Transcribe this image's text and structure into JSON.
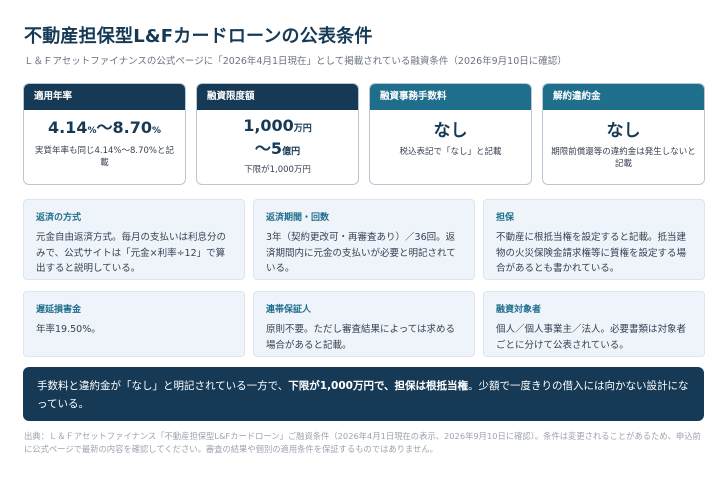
{
  "page": {
    "title": "不動産担保型L&Fカードローンの公表条件",
    "subtitle": "Ｌ＆Ｆアセットファイナンスの公式ページに「2026年4月1日現在」として掲載されている融資条件（2026年9月10日に確認）"
  },
  "stats": {
    "rate": {
      "label": "適用年率",
      "value_min": "4.14",
      "unit_min": "%",
      "sep": "〜",
      "value_max": "8.70",
      "unit_max": "%",
      "note": "実質年率も同じ4.14%〜8.70%と記載"
    },
    "limit": {
      "label": "融資限度額",
      "line1_value": "1,000",
      "line1_unit": "万円",
      "line2_value": "〜5",
      "line2_unit": "億円",
      "note": "下限が1,000万円"
    },
    "fee": {
      "label": "融資事務手数料",
      "value": "なし",
      "note": "税込表記で「なし」と記載"
    },
    "penalty": {
      "label": "解約違約金",
      "value": "なし",
      "note": "期限前償還等の違約金は発生しないと記載"
    }
  },
  "details": [
    {
      "title": "返済の方式",
      "text": "元金自由返済方式。毎月の支払いは利息分のみで、公式サイトは「元金×利率÷12」で算出すると説明している。"
    },
    {
      "title": "返済期間・回数",
      "text": "3年（契約更改可・再審査あり）／36回。返済期間内に元金の支払いが必要と明記されている。"
    },
    {
      "title": "担保",
      "text": "不動産に根抵当権を設定すると記載。抵当建物の火災保険金請求権等に質権を設定する場合があるとも書かれている。"
    },
    {
      "title": "遅延損害金",
      "text": "年率19.50%。"
    },
    {
      "title": "連帯保証人",
      "text": "原則不要。ただし審査結果によっては求める場合があると記載。"
    },
    {
      "title": "融資対象者",
      "text": "個人／個人事業主／法人。必要書類は対象者ごとに分けて公表されている。"
    }
  ],
  "summary": {
    "part1": "手数料と違約金が「なし」と明記されている一方で、",
    "bold1": "下限が1,000万円で、担保は根抵当権",
    "part2": "。少額で一度きりの借入には向かない設計になっている。"
  },
  "footnote": "出典：Ｌ＆Ｆアセットファイナンス「不動産担保型L&Fカードローン」ご融資条件（2026年4月1日現在の表示、2026年9月10日に確認）。条件は変更されることがあるため、申込前に公式ページで最新の内容を確認してください。審査の結果や個別の適用条件を保証するものではありません。",
  "colors": {
    "navy": "#163a56",
    "teal": "#1f6e8c",
    "card_bg": "#eef4fa"
  }
}
